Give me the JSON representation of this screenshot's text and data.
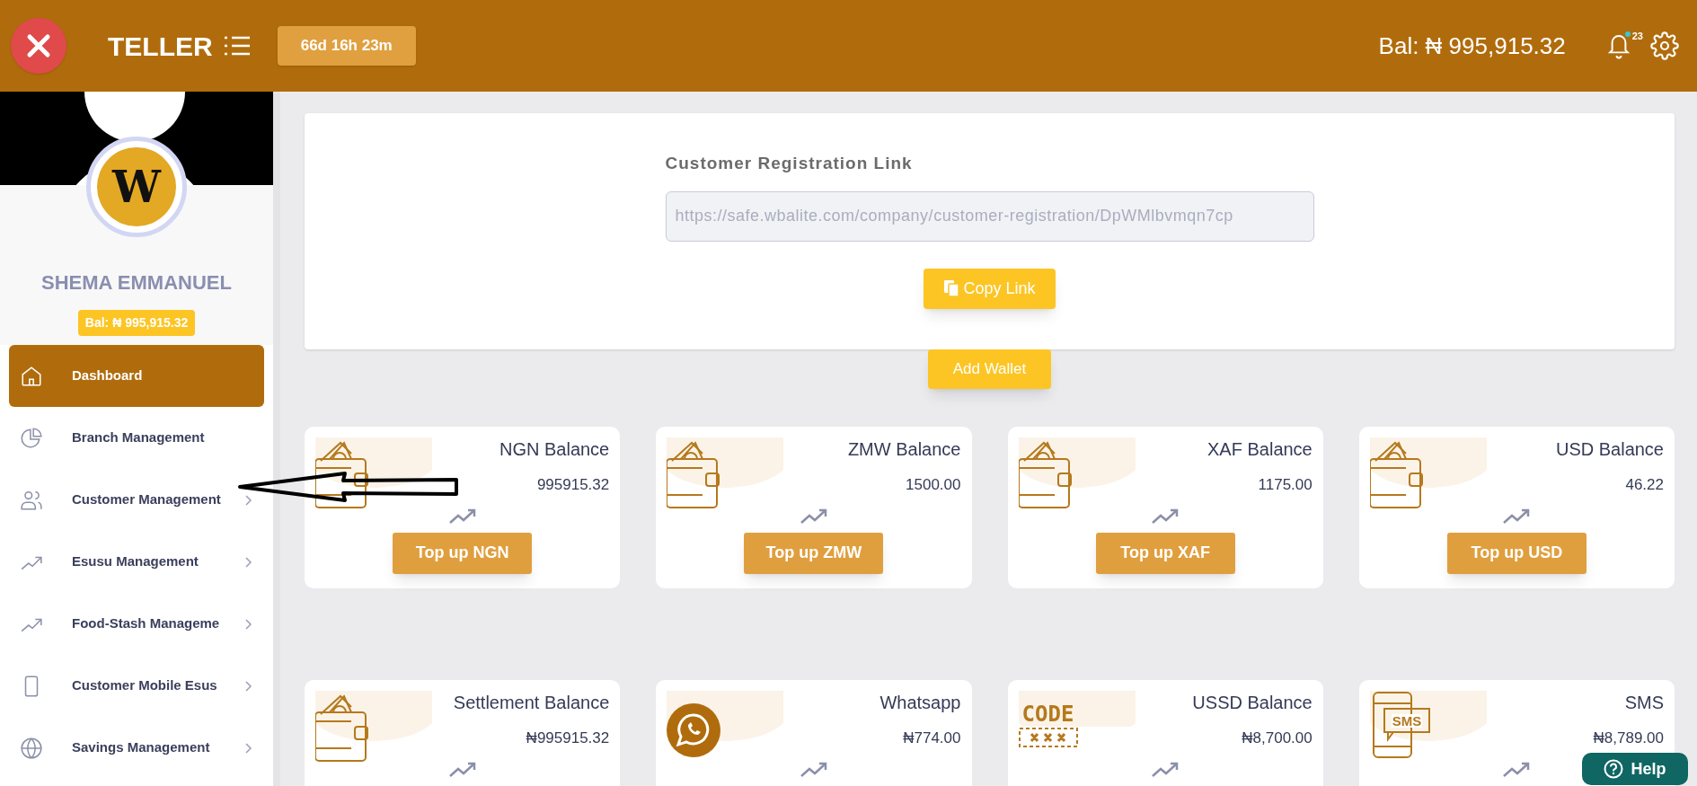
{
  "header": {
    "title": "TELLER",
    "timer": "66d 16h 23m",
    "balance": "Bal: ₦ 995,915.32",
    "notification_count": "23"
  },
  "profile": {
    "avatar_letter": "W",
    "name": "SHEMA EMMANUEL",
    "balance": "Bal: ₦ 995,915.32"
  },
  "sidebar": {
    "items": [
      {
        "label": "Dashboard",
        "kind": "home",
        "selected": true,
        "has_submenu": false
      },
      {
        "label": "Branch Management",
        "kind": "pie",
        "selected": false,
        "has_submenu": false
      },
      {
        "label": "Customer Management",
        "kind": "users",
        "selected": false,
        "has_submenu": true
      },
      {
        "label": "Esusu Management",
        "kind": "trend",
        "selected": false,
        "has_submenu": true
      },
      {
        "label": "Food-Stash Manageme",
        "kind": "trend",
        "selected": false,
        "has_submenu": true
      },
      {
        "label": "Customer Mobile Esus",
        "kind": "phone",
        "selected": false,
        "has_submenu": true
      },
      {
        "label": "Savings Management",
        "kind": "globe",
        "selected": false,
        "has_submenu": true
      }
    ]
  },
  "registration": {
    "label": "Customer Registration Link",
    "value": "https://safe.wbalite.com/company/customer-registration/DpWMlbvmqn7cp",
    "copy_button": "Copy Link"
  },
  "add_wallet": "Add Wallet",
  "balances": [
    {
      "kind": "wallet",
      "title": "NGN Balance",
      "amount": "995915.32",
      "button": "Top up NGN"
    },
    {
      "kind": "wallet",
      "title": "ZMW Balance",
      "amount": "1500.00",
      "button": "Top up ZMW"
    },
    {
      "kind": "wallet",
      "title": "XAF Balance",
      "amount": "1175.00",
      "button": "Top up XAF"
    },
    {
      "kind": "wallet",
      "title": "USD Balance",
      "amount": "46.22",
      "button": "Top up USD"
    },
    {
      "kind": "wallet",
      "title": "Settlement Balance",
      "amount": "₦995915.32"
    },
    {
      "kind": "whatsapp",
      "title": "Whatsapp",
      "amount": "₦774.00"
    },
    {
      "kind": "code",
      "icon_label": "CODE",
      "title": "USSD Balance",
      "amount": "₦8,700.00"
    },
    {
      "kind": "sms",
      "icon_label": "SMS",
      "title": "SMS",
      "amount": "₦8,789.00"
    }
  ],
  "help": "Help"
}
